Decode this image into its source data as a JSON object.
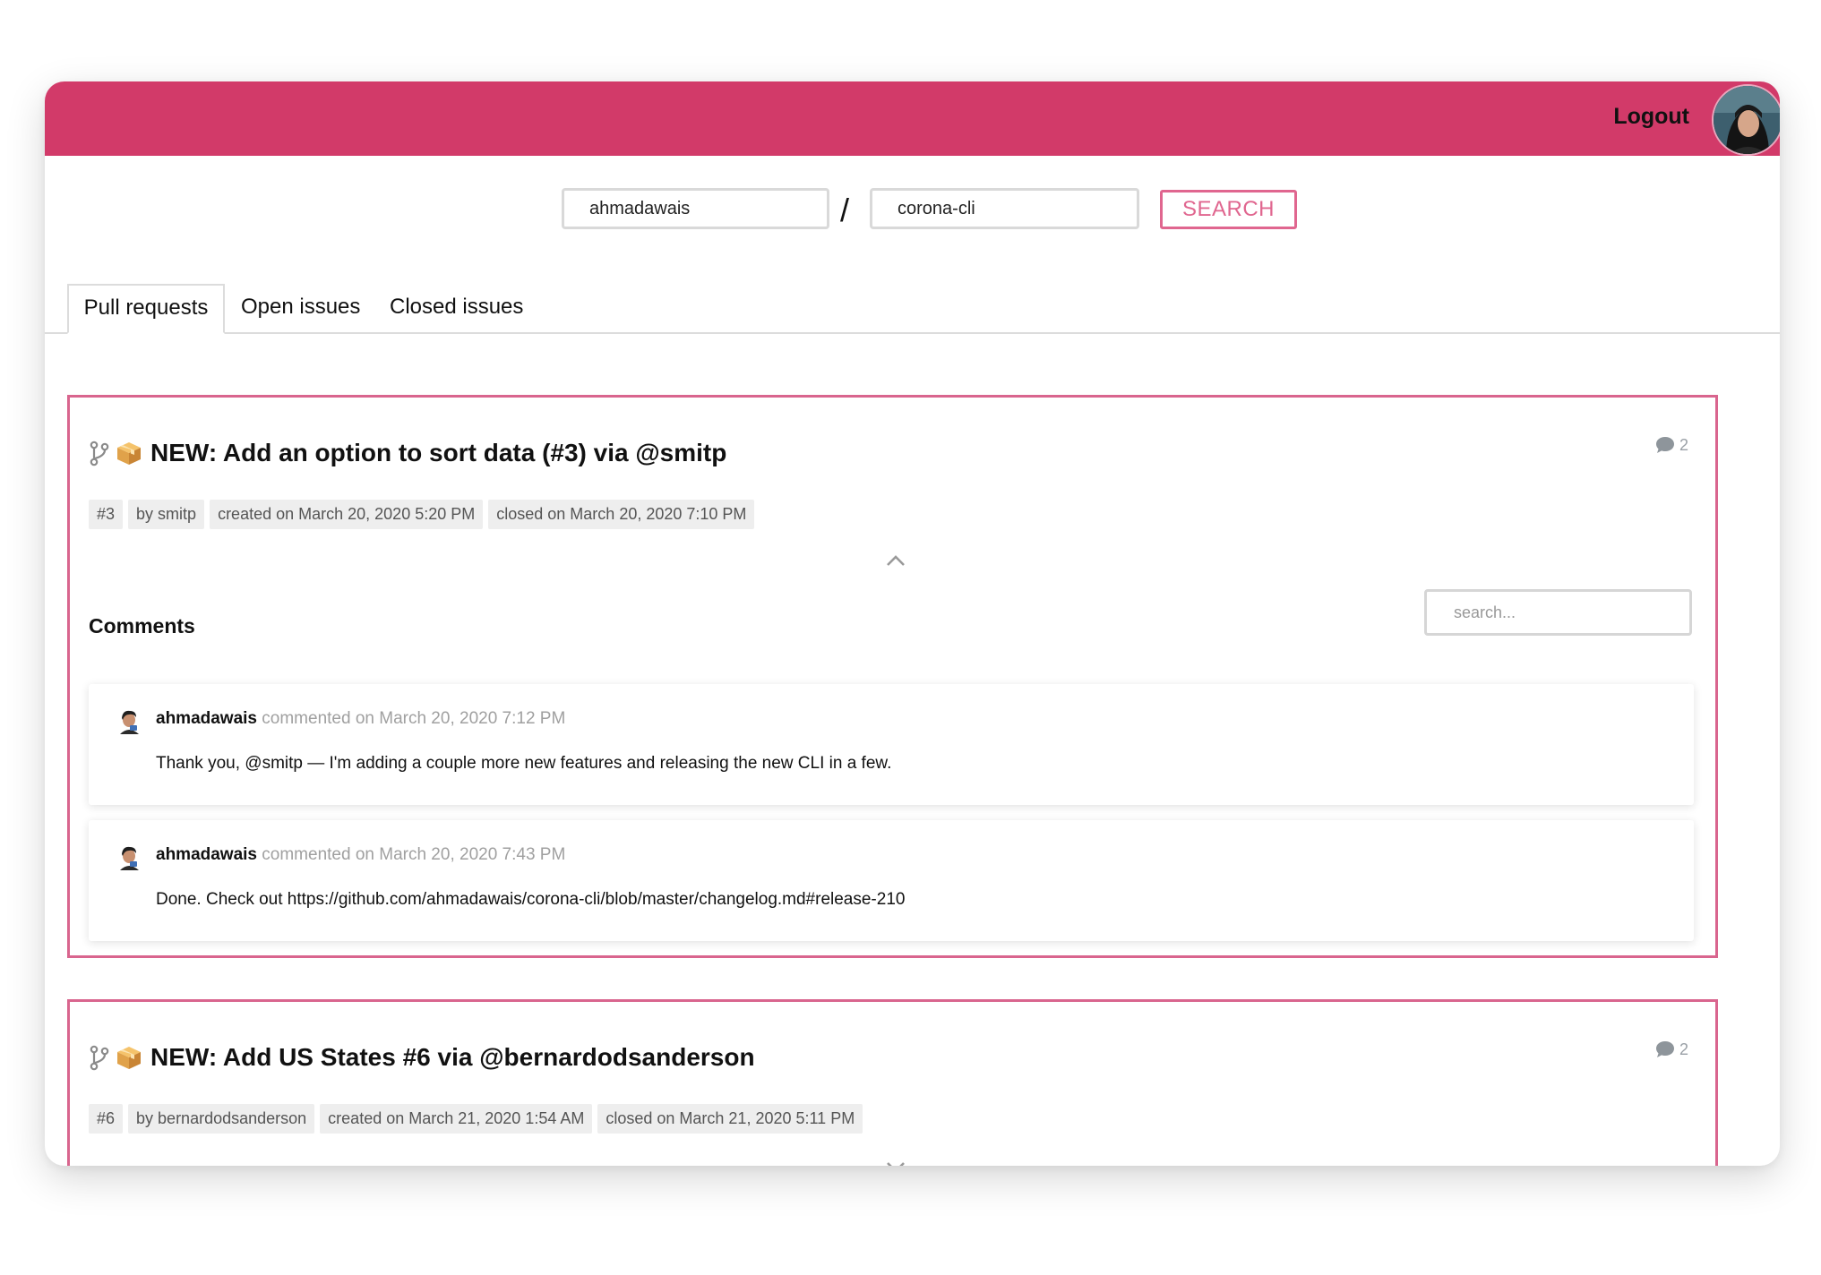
{
  "header": {
    "logout_label": "Logout",
    "accent_color": "#d23a69"
  },
  "search": {
    "owner_value": "ahmadawais",
    "separator": "/",
    "repo_value": "corona-cli",
    "button_label": "SEARCH"
  },
  "tabs": [
    {
      "label": "Pull requests",
      "active": true
    },
    {
      "label": "Open issues",
      "active": false
    },
    {
      "label": "Closed issues",
      "active": false
    }
  ],
  "pull_requests": [
    {
      "title": "NEW: Add an option to sort data (#3) via @smitp",
      "comment_count": "2",
      "tags": [
        "#3",
        "by smitp",
        "created on March 20, 2020 5:20 PM",
        "closed on March 20, 2020 7:10 PM"
      ],
      "expanded": true,
      "comments_label": "Comments",
      "comment_search_placeholder": "search...",
      "comments": [
        {
          "author": "ahmadawais",
          "meta": " commented on March 20, 2020 7:12 PM",
          "body": "Thank you, @smitp — I'm adding a couple more new features and releasing the new CLI in a few."
        },
        {
          "author": "ahmadawais",
          "meta": " commented on March 20, 2020 7:43 PM",
          "body": "Done. Check out https://github.com/ahmadawais/corona-cli/blob/master/changelog.md#release-210"
        }
      ]
    },
    {
      "title": "NEW: Add US States #6 via @bernardodsanderson",
      "comment_count": "2",
      "tags": [
        "#6",
        "by bernardodsanderson",
        "created on March 21, 2020 1:54 AM",
        "closed on March 21, 2020 5:11 PM"
      ],
      "expanded": false
    }
  ],
  "icons": {
    "pr": "git-branch-icon",
    "package": "package-box-icon",
    "comments": "speech-bubble-icon",
    "collapse": "chevron-up-icon",
    "expand": "chevron-down-icon"
  }
}
